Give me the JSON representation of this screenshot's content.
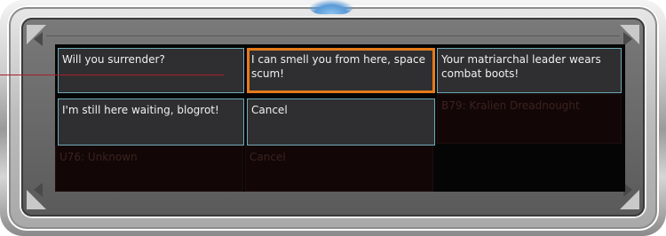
{
  "dialogue": {
    "options": [
      {
        "text": "Will you surrender?"
      },
      {
        "text": "I can smell you from here, space scum!"
      },
      {
        "text": "Your matriarchal leader wears combat boots!"
      },
      {
        "text": "I'm still here waiting, blogrot!"
      },
      {
        "text": "Cancel"
      }
    ],
    "selected_index": 1
  },
  "background_labels": {
    "target": "B79: Kralien Dreadnought",
    "unknown": "U76: Unknown",
    "cancel": "Cancel"
  },
  "colors": {
    "choice_border": "#6ea9b7",
    "selected_border": "#e67a1a",
    "pointer_line": "#a8202a",
    "top_glow": "#5a9ad8"
  }
}
